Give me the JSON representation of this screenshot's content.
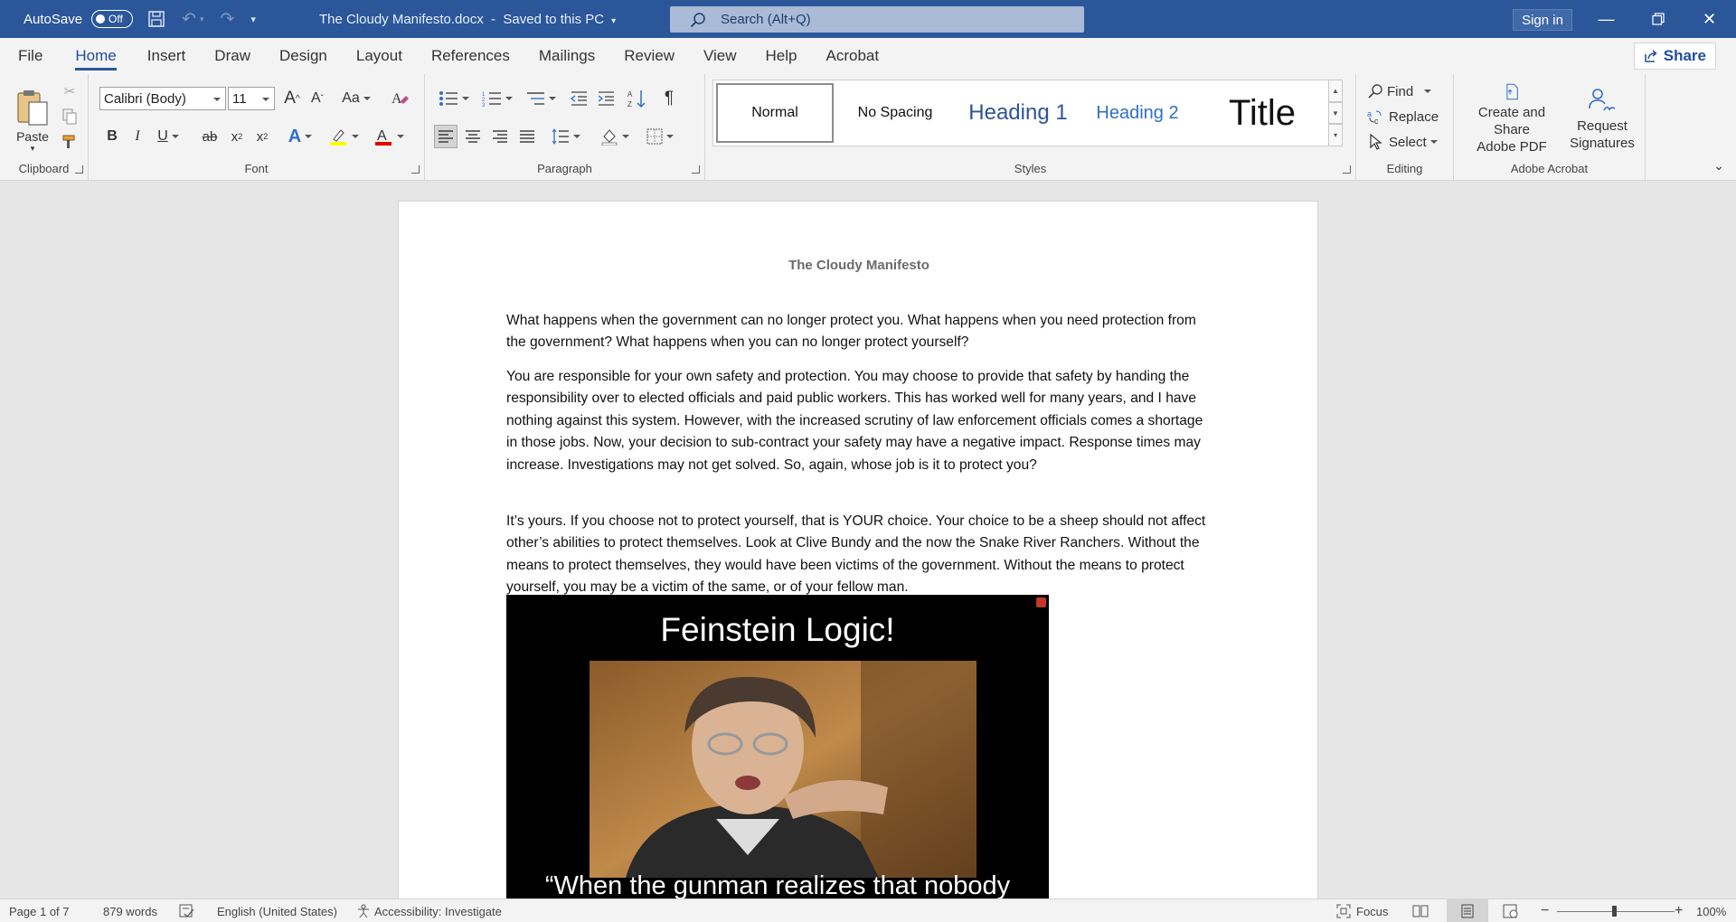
{
  "titlebar": {
    "autosave_label": "AutoSave",
    "autosave_state": "Off",
    "doc_title": "The Cloudy Manifesto.docx",
    "save_status": "Saved to this PC",
    "search_placeholder": "Search (Alt+Q)",
    "signin_label": "Sign in",
    "accent_color": "#2b579a"
  },
  "menu": {
    "tabs": [
      "File",
      "Home",
      "Insert",
      "Draw",
      "Design",
      "Layout",
      "References",
      "Mailings",
      "Review",
      "View",
      "Help",
      "Acrobat"
    ],
    "active_tab": "Home",
    "share_label": "Share"
  },
  "ribbon": {
    "clipboard": {
      "label": "Clipboard",
      "paste_label": "Paste"
    },
    "font": {
      "label": "Font",
      "font_name": "Calibri (Body)",
      "font_size": "11",
      "case_label": "Aa",
      "bold": "B",
      "italic": "I",
      "underline": "U",
      "strike": "ab",
      "sub": "x",
      "sub_mark": "2",
      "sup": "x",
      "sup_mark": "2",
      "effects": "A",
      "highlight_color": "#ffff00",
      "font_color": "#e00000",
      "grow_font": "A",
      "shrink_font": "A"
    },
    "paragraph": {
      "label": "Paragraph"
    },
    "styles": {
      "label": "Styles",
      "items": [
        "Normal",
        "No Spacing",
        "Heading 1",
        "Heading 2",
        "Title"
      ],
      "selected": "Normal"
    },
    "editing": {
      "label": "Editing",
      "find": "Find",
      "replace": "Replace",
      "select": "Select"
    },
    "acrobat": {
      "label": "Adobe Acrobat",
      "create_line1": "Create and Share",
      "create_line2": "Adobe PDF",
      "request_line1": "Request",
      "request_line2": "Signatures"
    }
  },
  "document": {
    "heading": "The Cloudy Manifesto",
    "paragraphs": [
      "What happens when the government can no longer protect you. What happens when you need protection from the government? What happens when you can no longer protect yourself?",
      "You are responsible for your own safety and protection. You may choose to provide that safety by handing the responsibility over to elected officials and paid public workers. This has worked well for many years, and I have nothing against this system. However, with the increased scrutiny of law enforcement officials comes a shortage in those jobs. Now, your decision to sub-contract your safety may have a negative impact. Response times may increase. Investigations may not get solved. So, again, whose job is it to protect you?",
      "It’s yours. If you choose not to protect yourself, that is YOUR choice. Your choice to be a sheep should not affect other’s abilities to protect themselves. Look at Clive Bundy and the now the Snake River Ranchers. Without the means to protect themselves, they would have been victims of the government. Without the means to protect yourself, you may be a victim of the same, or of your fellow man."
    ],
    "image": {
      "title": "Feinstein Logic!",
      "caption": "“When the gunman realizes that nobody"
    }
  },
  "statusbar": {
    "page": "Page 1 of 7",
    "words": "879 words",
    "language": "English (United States)",
    "accessibility": "Accessibility: Investigate",
    "focus": "Focus",
    "zoom": "100%"
  }
}
